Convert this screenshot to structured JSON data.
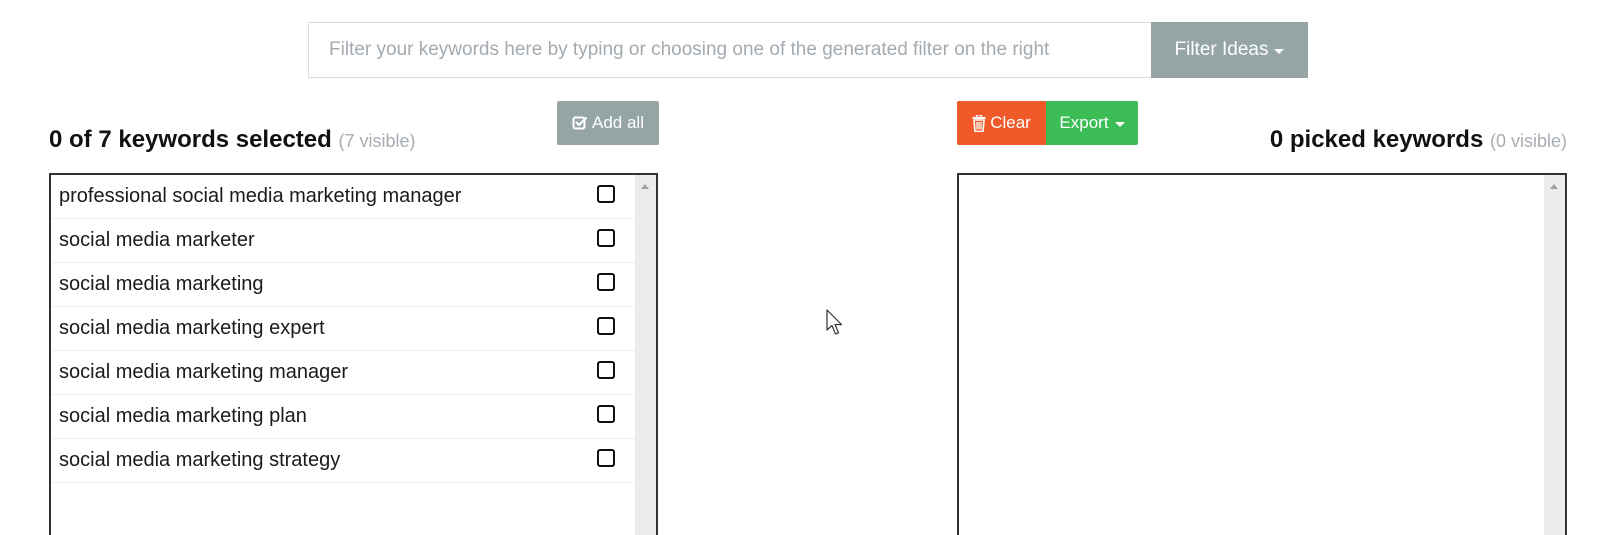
{
  "filter": {
    "placeholder": "Filter your keywords here by typing or choosing one of the generated filter on the right",
    "value": "",
    "ideas_button": "Filter Ideas"
  },
  "left_panel": {
    "title": "0 of 7 keywords selected",
    "visible_note": "(7 visible)",
    "add_all_button": "Add all",
    "keywords": [
      {
        "label": "professional social media marketing manager",
        "checked": false
      },
      {
        "label": "social media marketer",
        "checked": false
      },
      {
        "label": "social media marketing",
        "checked": false
      },
      {
        "label": "social media marketing expert",
        "checked": false
      },
      {
        "label": "social media marketing manager",
        "checked": false
      },
      {
        "label": "social media marketing plan",
        "checked": false
      },
      {
        "label": "social media marketing strategy",
        "checked": false
      }
    ]
  },
  "right_panel": {
    "clear_button": "Clear",
    "export_button": "Export",
    "title": "0 picked keywords",
    "visible_note": "(0 visible)",
    "picked": []
  },
  "colors": {
    "filter_ideas_bg": "#95a5a6",
    "add_all_bg": "#95a5a6",
    "clear_bg": "#f05a28",
    "export_bg": "#3cbd55"
  },
  "icons": {
    "add_all": "check-square-icon",
    "clear": "trash-icon",
    "caret": "caret-down-icon",
    "checkbox": "square-icon",
    "pointer": "mouse-pointer-icon"
  }
}
